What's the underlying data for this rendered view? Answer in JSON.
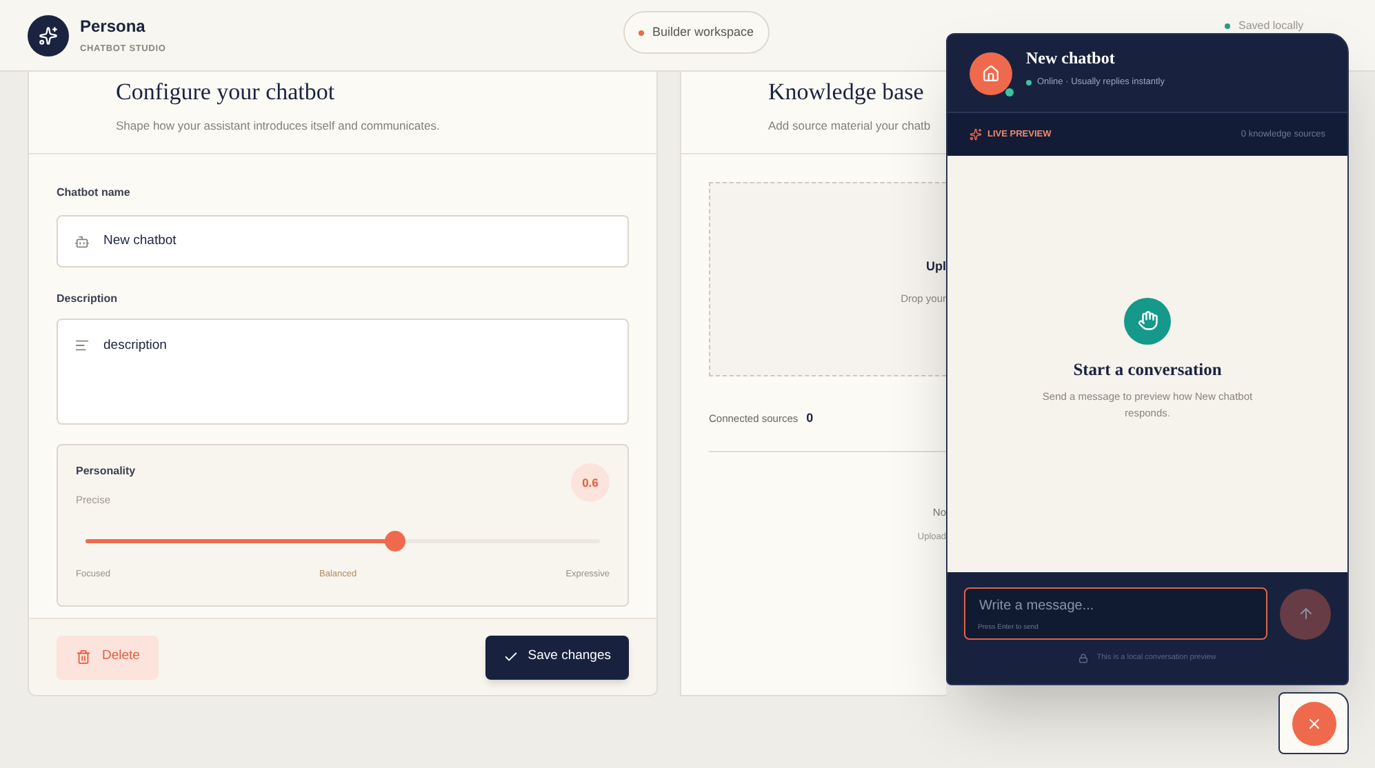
{
  "header": {
    "brand": "Persona",
    "subtitle": "CHATBOT STUDIO",
    "workspace": "Builder workspace",
    "save_status": "Saved locally"
  },
  "config": {
    "title": "Configure your chatbot",
    "subtitle": "Shape how your assistant introduces itself and communicates.",
    "name_label": "Chatbot name",
    "name_value": "New chatbot",
    "description_label": "Description",
    "description_value": "description",
    "personality": {
      "label": "Personality",
      "mode": "Precise",
      "value": "0.6",
      "level": 0.6,
      "scale": [
        "Focused",
        "Balanced",
        "Expressive"
      ]
    },
    "delete_button": "Delete",
    "save_button": "Save changes"
  },
  "knowledge": {
    "title": "Knowledge base",
    "subtitle": "Add source material your chatb",
    "upload_title": "Upl",
    "upload_hint": "Drop your",
    "connected_label": "Connected sources",
    "connected_count": "0",
    "empty_title": "No",
    "empty_hint": "Upload"
  },
  "chat": {
    "name": "New chatbot",
    "online": true,
    "status": "Online · Usually replies instantly",
    "preview_label": "LIVE PREVIEW",
    "sources": "0 knowledge sources",
    "empty_title": "Start a conversation",
    "empty_text": "Send a message to preview how New chatbot responds.",
    "placeholder": "Write a message...",
    "hint": "Press Enter to send",
    "footer": "This is a local conversation preview"
  }
}
